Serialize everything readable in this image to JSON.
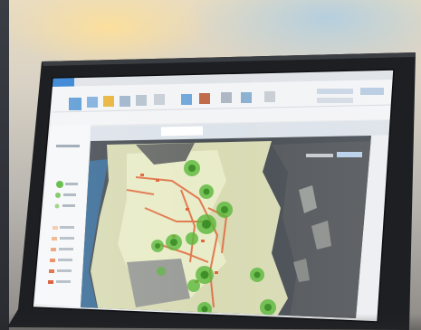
{
  "photo": {
    "subject": "monitor-displaying-gis-app",
    "colors": {
      "bezel": "#1d1f23",
      "ribbon": "#f3f4f6",
      "title_bar": "#2f7fd3",
      "ocean": "#3e6f99",
      "land_pale": "#e9ecc8",
      "cluster_green": "#58b83a",
      "route_red": "#e0653a"
    }
  }
}
